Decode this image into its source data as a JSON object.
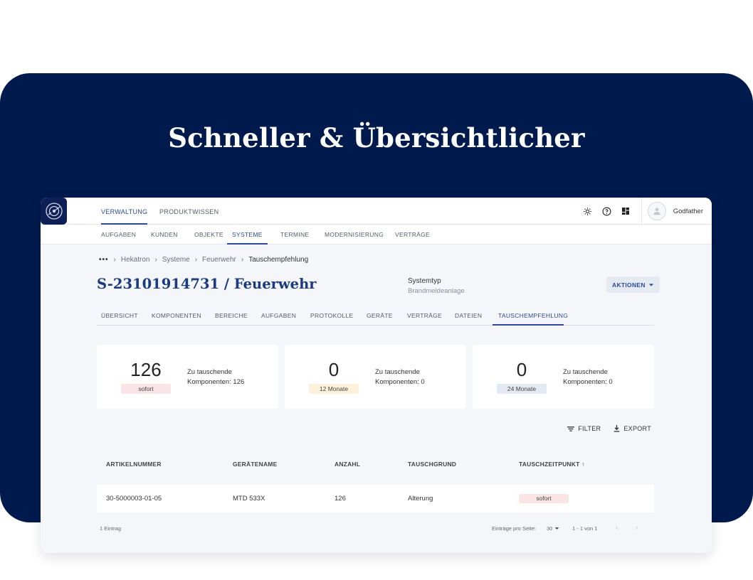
{
  "headline": "Schneller & Übersichtlicher",
  "top_tabs": [
    {
      "label": "VERWALTUNG",
      "active": true
    },
    {
      "label": "PRODUKTWISSEN",
      "active": false
    }
  ],
  "user": {
    "name": "Godfather"
  },
  "sub_tabs": [
    {
      "label": "AUFGABEN"
    },
    {
      "label": "KUNDEN"
    },
    {
      "label": "OBJEKTE"
    },
    {
      "label": "SYSTEME",
      "active": true
    },
    {
      "label": "TERMINE"
    },
    {
      "label": "MODERNISIERUNG"
    },
    {
      "label": "VERTRÄGE"
    }
  ],
  "breadcrumb": [
    "Hekatron",
    "Systeme",
    "Feuerwehr",
    "Tauschempfehlung"
  ],
  "page_title": "S-23101914731 / Feuerwehr",
  "systemtyp": {
    "label": "Systemtyp",
    "value": "Brandmeldeanlage"
  },
  "aktionen_label": "AKTIONEN",
  "object_tabs": [
    {
      "label": "ÜBERSICHT"
    },
    {
      "label": "KOMPONENTEN"
    },
    {
      "label": "BEREICHE"
    },
    {
      "label": "AUFGABEN"
    },
    {
      "label": "PROTOKOLLE"
    },
    {
      "label": "GERÄTE"
    },
    {
      "label": "VERTRÄGE"
    },
    {
      "label": "DATEIEN"
    },
    {
      "label": "TAUSCHEMPFEHLUNG",
      "active": true
    }
  ],
  "cards": [
    {
      "number": "126",
      "tag": "sofort",
      "tag_color": "#fbe4e6",
      "line1": "Zu tauschende",
      "line2": "Komponenten: 126"
    },
    {
      "number": "0",
      "tag": "12 Monate",
      "tag_color": "#fdf1d9",
      "line1": "Zu tauschende",
      "line2": "Komponenten: 0"
    },
    {
      "number": "0",
      "tag": "24 Monate",
      "tag_color": "#e3e9f3",
      "line1": "Zu tauschende",
      "line2": "Komponenten: 0"
    }
  ],
  "filter_label": "FILTER",
  "export_label": "EXPORT",
  "table": {
    "columns": [
      "ARTIKELNUMMER",
      "GERÄTENAME",
      "ANZAHL",
      "TAUSCHGRUND",
      "TAUSCHZEITPUNKT ↑"
    ],
    "rows": [
      {
        "artikelnummer": "30-5000003-01-05",
        "geraetename": "MTD 533X",
        "anzahl": "126",
        "tauschgrund": "Alterung",
        "tauschzeitpunkt": "sofort"
      }
    ]
  },
  "footer": {
    "count": "1 Eintrag",
    "per_page_label": "Einträge pro Seite:",
    "per_page_value": "30",
    "range": "1 - 1 von 1"
  },
  "colors": {
    "banner": "#001a4d",
    "accent": "#2c4a96",
    "title": "#1c3a80"
  }
}
